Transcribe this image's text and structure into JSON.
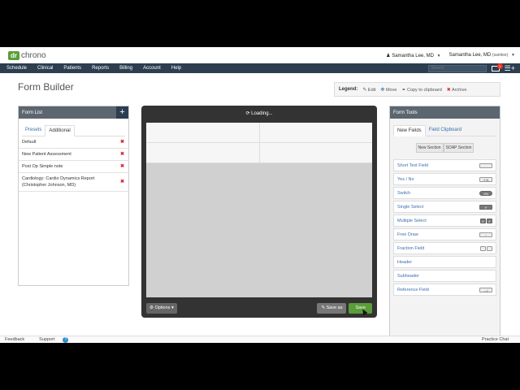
{
  "brand": {
    "badge": "dr",
    "name": "chrono",
    "color": "#5a9e3a"
  },
  "topbar": {
    "user1": "Samantha Lee, MD",
    "user2": "Samantha Lee, MD",
    "user2_note": "(samlee)"
  },
  "nav": {
    "items": [
      "Schedule",
      "Clinical",
      "Patients",
      "Reports",
      "Billing",
      "Account",
      "Help"
    ],
    "search_placeholder": "Search",
    "mail_badge": "1"
  },
  "page": {
    "title": "Form Builder"
  },
  "legend": {
    "label": "Legend:",
    "edit": "Edit",
    "move": "Move",
    "copy": "Copy to clipboard",
    "archive": "Archive"
  },
  "form_list": {
    "title": "Form List",
    "tabs": [
      "Presets",
      "Additional"
    ],
    "active_tab": "Additional",
    "items": [
      "Default",
      "New Patient Assessment",
      "Post Op Simple note",
      "Cardiology: Cardio Dynamics Report (Christopher Johnson, MD)"
    ]
  },
  "canvas": {
    "loading": "Loading...",
    "options": "Options",
    "save_as": "Save as",
    "save": "Save"
  },
  "form_tools": {
    "title": "Form Tools",
    "tabs": [
      "New Fields",
      "Field Clipboard"
    ],
    "active_tab": "New Fields",
    "section_buttons": [
      "New Section",
      "SOAP Section"
    ],
    "fields": [
      "Short Text Field",
      "Yes / No",
      "Switch",
      "Single Select",
      "Multiple Select",
      "Free Draw",
      "Fraction Field",
      "Header",
      "Subheader",
      "Reference Field"
    ]
  },
  "footer": {
    "feedback": "Feedback",
    "support": "Support",
    "chat": "Practice Chat"
  }
}
